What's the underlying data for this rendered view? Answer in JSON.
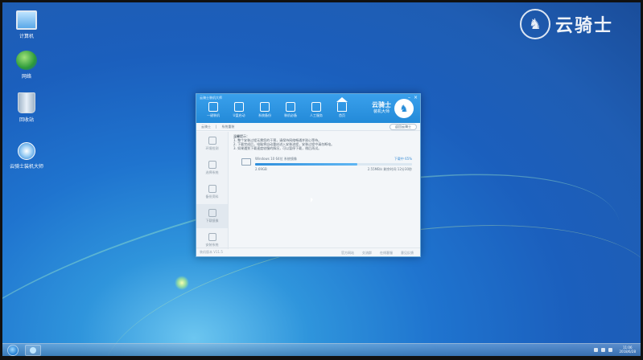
{
  "watermark": {
    "text": "云骑士"
  },
  "desktop": {
    "icons": [
      {
        "label": "计算机"
      },
      {
        "label": "网络"
      },
      {
        "label": "回收站"
      },
      {
        "label": "云骑士装机大师"
      }
    ]
  },
  "window": {
    "title": "云骑士装机大师",
    "nav": [
      {
        "label": "一键装机"
      },
      {
        "label": "U盘启动"
      },
      {
        "label": "系统备份"
      },
      {
        "label": "装机必备"
      },
      {
        "label": "人工服务"
      },
      {
        "label": "首页"
      }
    ],
    "brand": {
      "name": "云骑士",
      "sub": "装机大师"
    },
    "breadcrumb": {
      "step1": "云骑士",
      "step2": "系统重装",
      "back": "返回云骑士"
    },
    "sidebar": [
      {
        "label": "环境检测"
      },
      {
        "label": "选择系统"
      },
      {
        "label": "备份资料"
      },
      {
        "label": "下载镜像"
      },
      {
        "label": "安装系统"
      }
    ],
    "tips": {
      "head": "温馨提示：",
      "lines": [
        "1. 整个安装过程无需您的干预，请保持网络畅通并耐心等待。",
        "2. 下载完成后，电脑将自动重启进入安装流程，安装过程中请勿断电。",
        "3. 如果遇到下载速度较慢的情况，可以暂停下载，稍后再试。"
      ]
    },
    "download": {
      "name": "Windows 10 64位 系统镜像",
      "percent": "下载中 65%",
      "size_done": "2.69GB",
      "speed_info": "2.55MB/s  剩余时间 12分30秒",
      "progress": 0.65
    },
    "footer": {
      "version": "装机版本 V11.5",
      "links": [
        "官方网站",
        "交流群",
        "在线客服",
        "意见反馈"
      ]
    }
  },
  "taskbar": {
    "time": "11:06",
    "date": "2018/6/28"
  }
}
